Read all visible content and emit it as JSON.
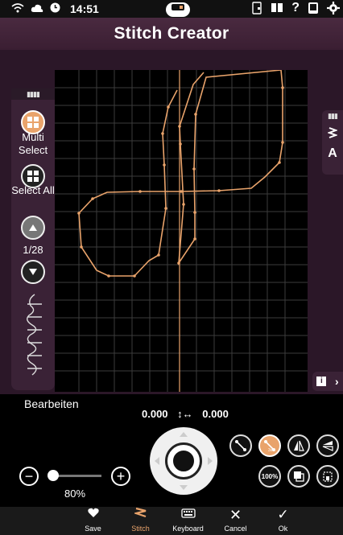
{
  "status": {
    "time": "14:51"
  },
  "title": "Stitch Creator",
  "left_panel": {
    "multi_select_label": "Multi Select",
    "select_all_label": "Select All",
    "page_indicator": "1/28"
  },
  "edit_label": "Bearbeiten",
  "coordinates": {
    "x": "0.000",
    "y": "0.000"
  },
  "zoom": {
    "value": "80%",
    "fraction": 0.0
  },
  "tools": {
    "fit_label": "100%"
  },
  "right_panel": {
    "text_label": "A"
  },
  "bottom_bar": {
    "items": [
      {
        "label": "Save",
        "icon": "heart-icon"
      },
      {
        "label": "Stitch",
        "icon": "stitch-icon",
        "active": true
      },
      {
        "label": "Keyboard",
        "icon": "keyboard-icon"
      },
      {
        "label": "Cancel",
        "icon": "close-icon"
      },
      {
        "label": "Ok",
        "icon": "check-icon"
      }
    ]
  },
  "colors": {
    "accent": "#e9a36b",
    "panel": "#3a2236",
    "title_bar": "#4a2a40"
  }
}
